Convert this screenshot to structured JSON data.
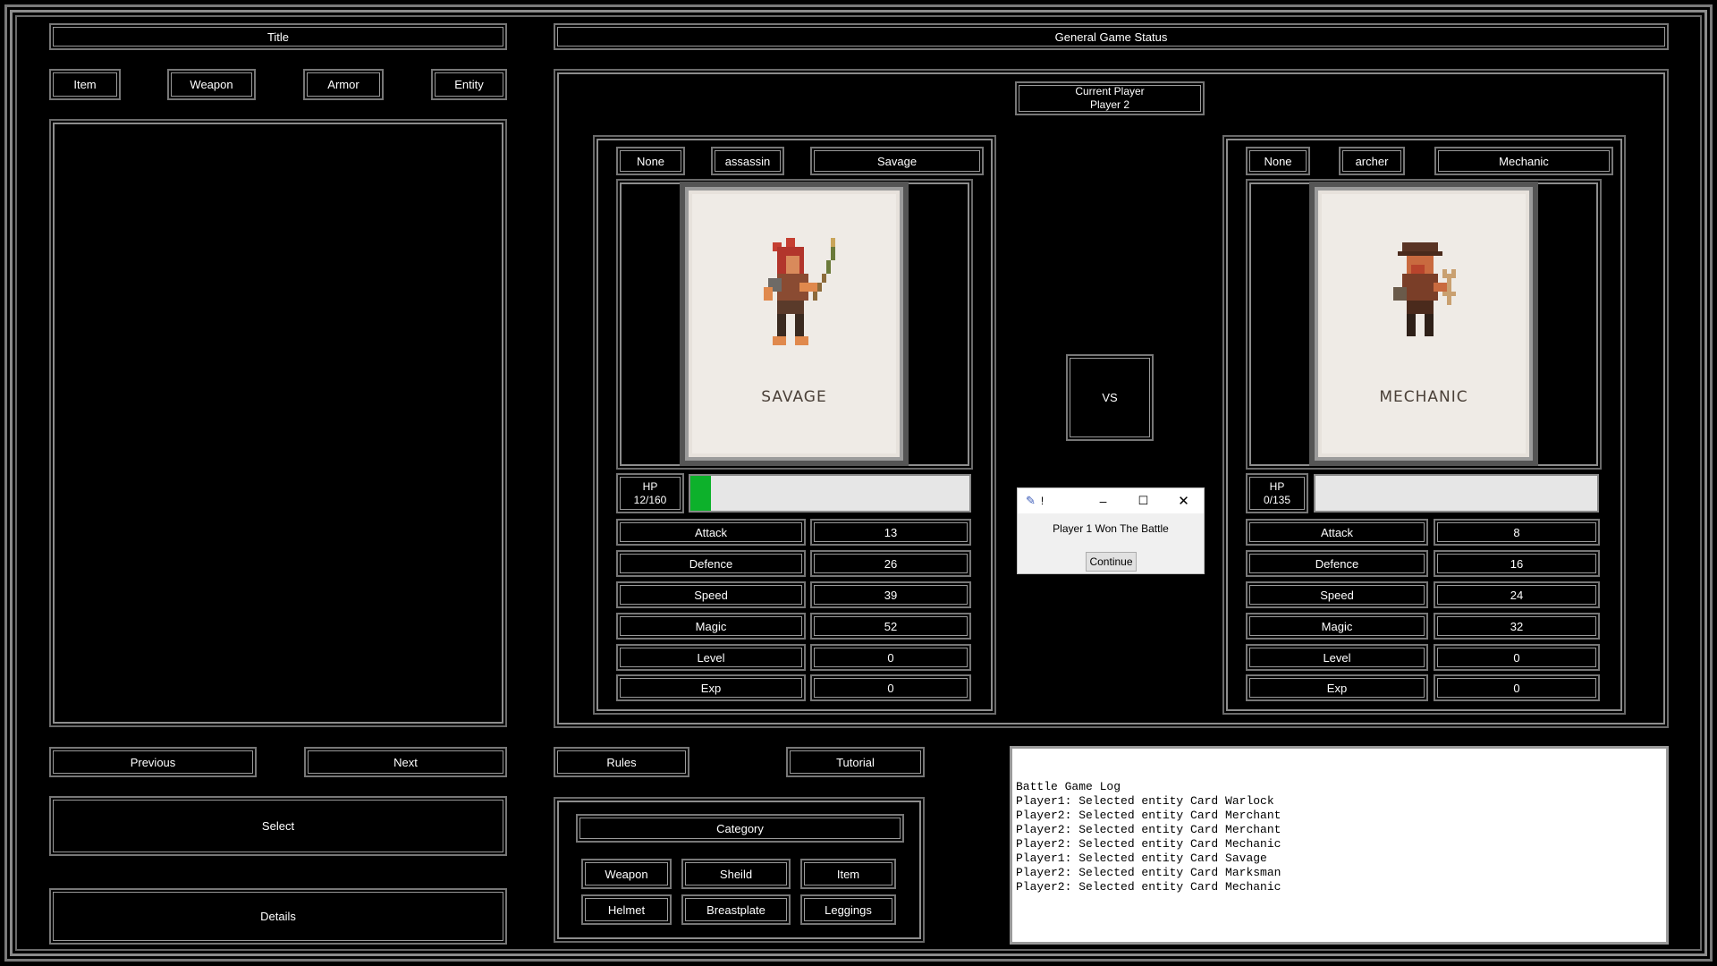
{
  "left_panel": {
    "title": "Title",
    "categories": [
      "Item",
      "Weapon",
      "Armor",
      "Entity"
    ],
    "previous": "Previous",
    "next": "Next",
    "select": "Select",
    "details": "Details"
  },
  "status": {
    "title": "General Game Status",
    "current_player": "Current Player\nPlayer 2",
    "vs": "VS"
  },
  "player1": {
    "slot": "None",
    "class": "assassin",
    "name": "Savage",
    "card_title": "SAVAGE",
    "hp_label": "HP\n12/160",
    "hp_fraction": 0.075,
    "stats": [
      {
        "label": "Attack",
        "value": "13"
      },
      {
        "label": "Defence",
        "value": "26"
      },
      {
        "label": "Speed",
        "value": "39"
      },
      {
        "label": "Magic",
        "value": "52"
      },
      {
        "label": "Level",
        "value": "0"
      },
      {
        "label": "Exp",
        "value": "0"
      }
    ]
  },
  "player2": {
    "slot": "None",
    "class": "archer",
    "name": "Mechanic",
    "card_title": "MECHANIC",
    "hp_label": "HP\n0/135",
    "hp_fraction": 0,
    "stats": [
      {
        "label": "Attack",
        "value": "8"
      },
      {
        "label": "Defence",
        "value": "16"
      },
      {
        "label": "Speed",
        "value": "24"
      },
      {
        "label": "Magic",
        "value": "32"
      },
      {
        "label": "Level",
        "value": "0"
      },
      {
        "label": "Exp",
        "value": "0"
      }
    ]
  },
  "dialog": {
    "title": "!",
    "message": "Player 1 Won The Battle",
    "button": "Continue"
  },
  "bottom": {
    "rules": "Rules",
    "tutorial": "Tutorial",
    "category": "Category",
    "row1": [
      "Weapon",
      "Sheild",
      "Item"
    ],
    "row2": [
      "Helmet",
      "Breastplate",
      "Leggings"
    ]
  },
  "log": {
    "lines": [
      "Battle Game Log",
      "Player1: Selected entity Card Warlock",
      "Player2: Selected entity Card Merchant",
      "Player2: Selected entity Card Merchant",
      "Player2: Selected entity Card Mechanic",
      "Player1: Selected entity Card Savage",
      "Player2: Selected entity Card Marksman",
      "Player2: Selected entity Card Mechanic"
    ]
  },
  "colors": {
    "hp_fill": "#0db12b",
    "frame_gray": "#8d8d8d",
    "background": "#000000"
  }
}
